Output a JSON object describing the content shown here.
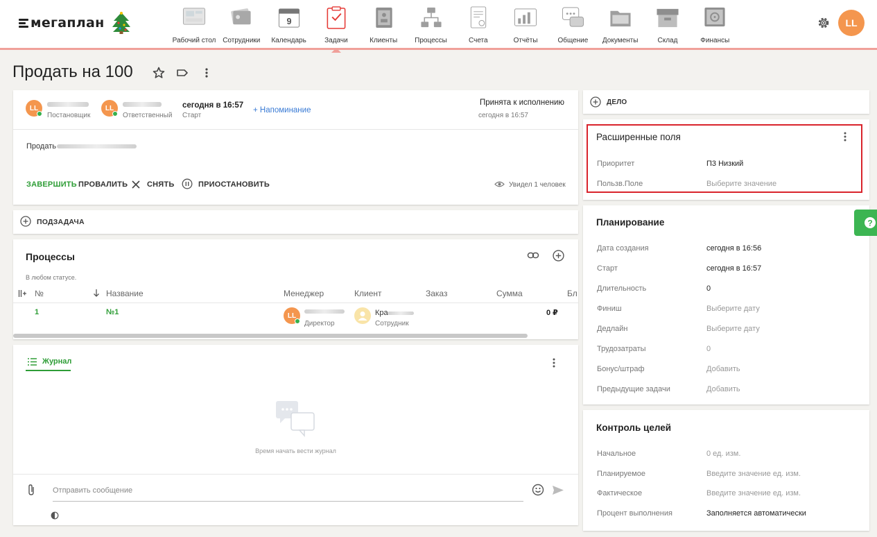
{
  "app": {
    "brand": "мегаплан",
    "avatar_initials": "LL"
  },
  "nav": [
    {
      "label": "Рабочий стол",
      "icon": "desktop-icon"
    },
    {
      "label": "Сотрудники",
      "icon": "employees-icon"
    },
    {
      "label": "Календарь",
      "icon": "calendar-icon",
      "day": "9"
    },
    {
      "label": "Задачи",
      "icon": "tasks-icon",
      "active": true
    },
    {
      "label": "Клиенты",
      "icon": "clients-icon"
    },
    {
      "label": "Процессы",
      "icon": "processes-icon"
    },
    {
      "label": "Счета",
      "icon": "invoices-icon"
    },
    {
      "label": "Отчёты",
      "icon": "reports-icon"
    },
    {
      "label": "Общение",
      "icon": "chat-icon"
    },
    {
      "label": "Документы",
      "icon": "documents-icon"
    },
    {
      "label": "Склад",
      "icon": "warehouse-icon"
    },
    {
      "label": "Финансы",
      "icon": "finance-icon"
    }
  ],
  "task": {
    "title": "Продать на 100",
    "creator": {
      "initials": "LL",
      "role": "Постановщик"
    },
    "responsible": {
      "initials": "LL",
      "role": "Ответственный"
    },
    "start": {
      "value": "сегодня в 16:57",
      "label": "Старт"
    },
    "reminder": "+ Напоминание",
    "status": {
      "value": "Принята к исполнению",
      "time": "сегодня в 16:57"
    },
    "description_prefix": "Продать",
    "actions": {
      "complete": "ЗАВЕРШИТЬ",
      "fail": "ПРОВАЛИТЬ",
      "remove": "СНЯТЬ",
      "pause": "ПРИОСТАНОВИТЬ"
    },
    "seen": "Увидел 1 человек"
  },
  "subtask": {
    "label": "ПОДЗАДАЧА"
  },
  "processes": {
    "title": "Процессы",
    "filter": "В любом статусе.",
    "columns": [
      "№",
      "Название",
      "Менеджер",
      "Клиент",
      "Заказ",
      "Сумма",
      "Бл"
    ],
    "rows": [
      {
        "num": "1",
        "name": "№1",
        "manager_initials": "LL",
        "manager_role": "Директор",
        "client_prefix": "Кра",
        "client_role": "Сотрудник",
        "sum": "0 ₽"
      }
    ]
  },
  "journal": {
    "tab": "Журнал",
    "empty": "Время начать вести журнал",
    "input_placeholder": "Отправить сообщение"
  },
  "deal": {
    "label": "ДЕЛО"
  },
  "extended": {
    "title": "Расширенные поля",
    "fields": [
      {
        "key": "Приоритет",
        "value": "П3 Низкий",
        "muted": false
      },
      {
        "key": "Пользв.Поле",
        "value": "Выберите значение",
        "muted": true
      }
    ]
  },
  "planning": {
    "title": "Планирование",
    "fields": [
      {
        "key": "Дата создания",
        "value": "сегодня в 16:56",
        "muted": false
      },
      {
        "key": "Старт",
        "value": "сегодня в 16:57",
        "muted": false
      },
      {
        "key": "Длительность",
        "value": "0",
        "muted": false
      },
      {
        "key": "Финиш",
        "value": "Выберите дату",
        "muted": true
      },
      {
        "key": "Дедлайн",
        "value": "Выберите дату",
        "muted": true
      },
      {
        "key": "Трудозатраты",
        "value": "0",
        "muted": true
      },
      {
        "key": "Бонус/штраф",
        "value": "Добавить",
        "muted": true
      },
      {
        "key": "Предыдущие задачи",
        "value": "Добавить",
        "muted": true
      }
    ]
  },
  "goals": {
    "title": "Контроль целей",
    "fields": [
      {
        "key": "Начальное",
        "value": "0  ед. изм.",
        "muted": true
      },
      {
        "key": "Планируемое",
        "value": "Введите значение  ед. изм.",
        "muted": true
      },
      {
        "key": "Фактическое",
        "value": "Введите значение  ед. изм.",
        "muted": true
      },
      {
        "key": "Процент выполнения",
        "value": "Заполняется автоматически",
        "muted": false
      }
    ]
  },
  "colors": {
    "accent_green": "#2e9d36",
    "brand_orange": "#f4964e",
    "highlight_red": "#d9232b",
    "link_blue": "#3a7bd5"
  }
}
